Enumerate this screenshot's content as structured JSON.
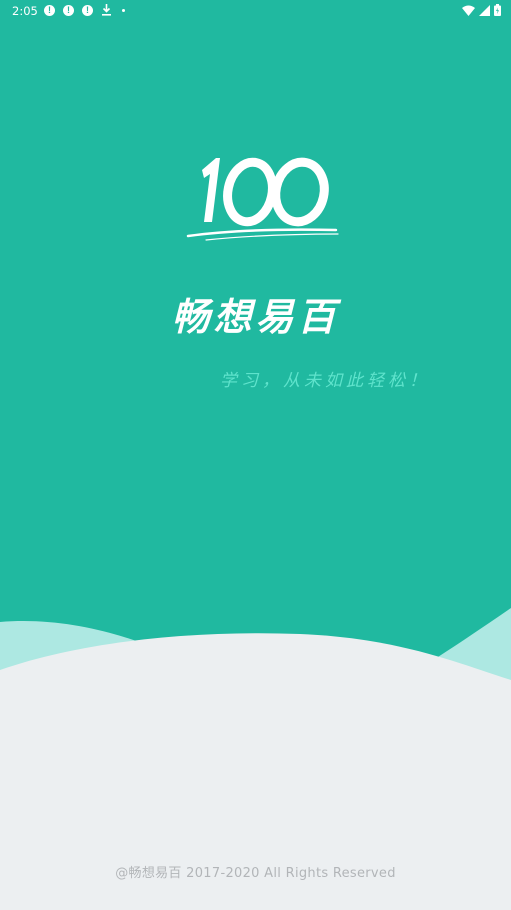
{
  "status_bar": {
    "time": "2:05",
    "notification_icons": [
      "alert-icon",
      "alert-icon",
      "alert-icon",
      "download-icon",
      "dot-icon"
    ],
    "system_icons": [
      "wifi-icon",
      "signal-icon",
      "battery-icon"
    ]
  },
  "splash": {
    "logo_text": "100",
    "brand_name": "畅想易百",
    "slogan": "学习，从未如此轻松！",
    "copyright": "@畅想易百 2017-2020 All Rights Reserved"
  },
  "colors": {
    "primary": "#20b9a0",
    "wave": "#ade8e2",
    "background": "#eceff1",
    "slogan": "#5fe3cc"
  }
}
